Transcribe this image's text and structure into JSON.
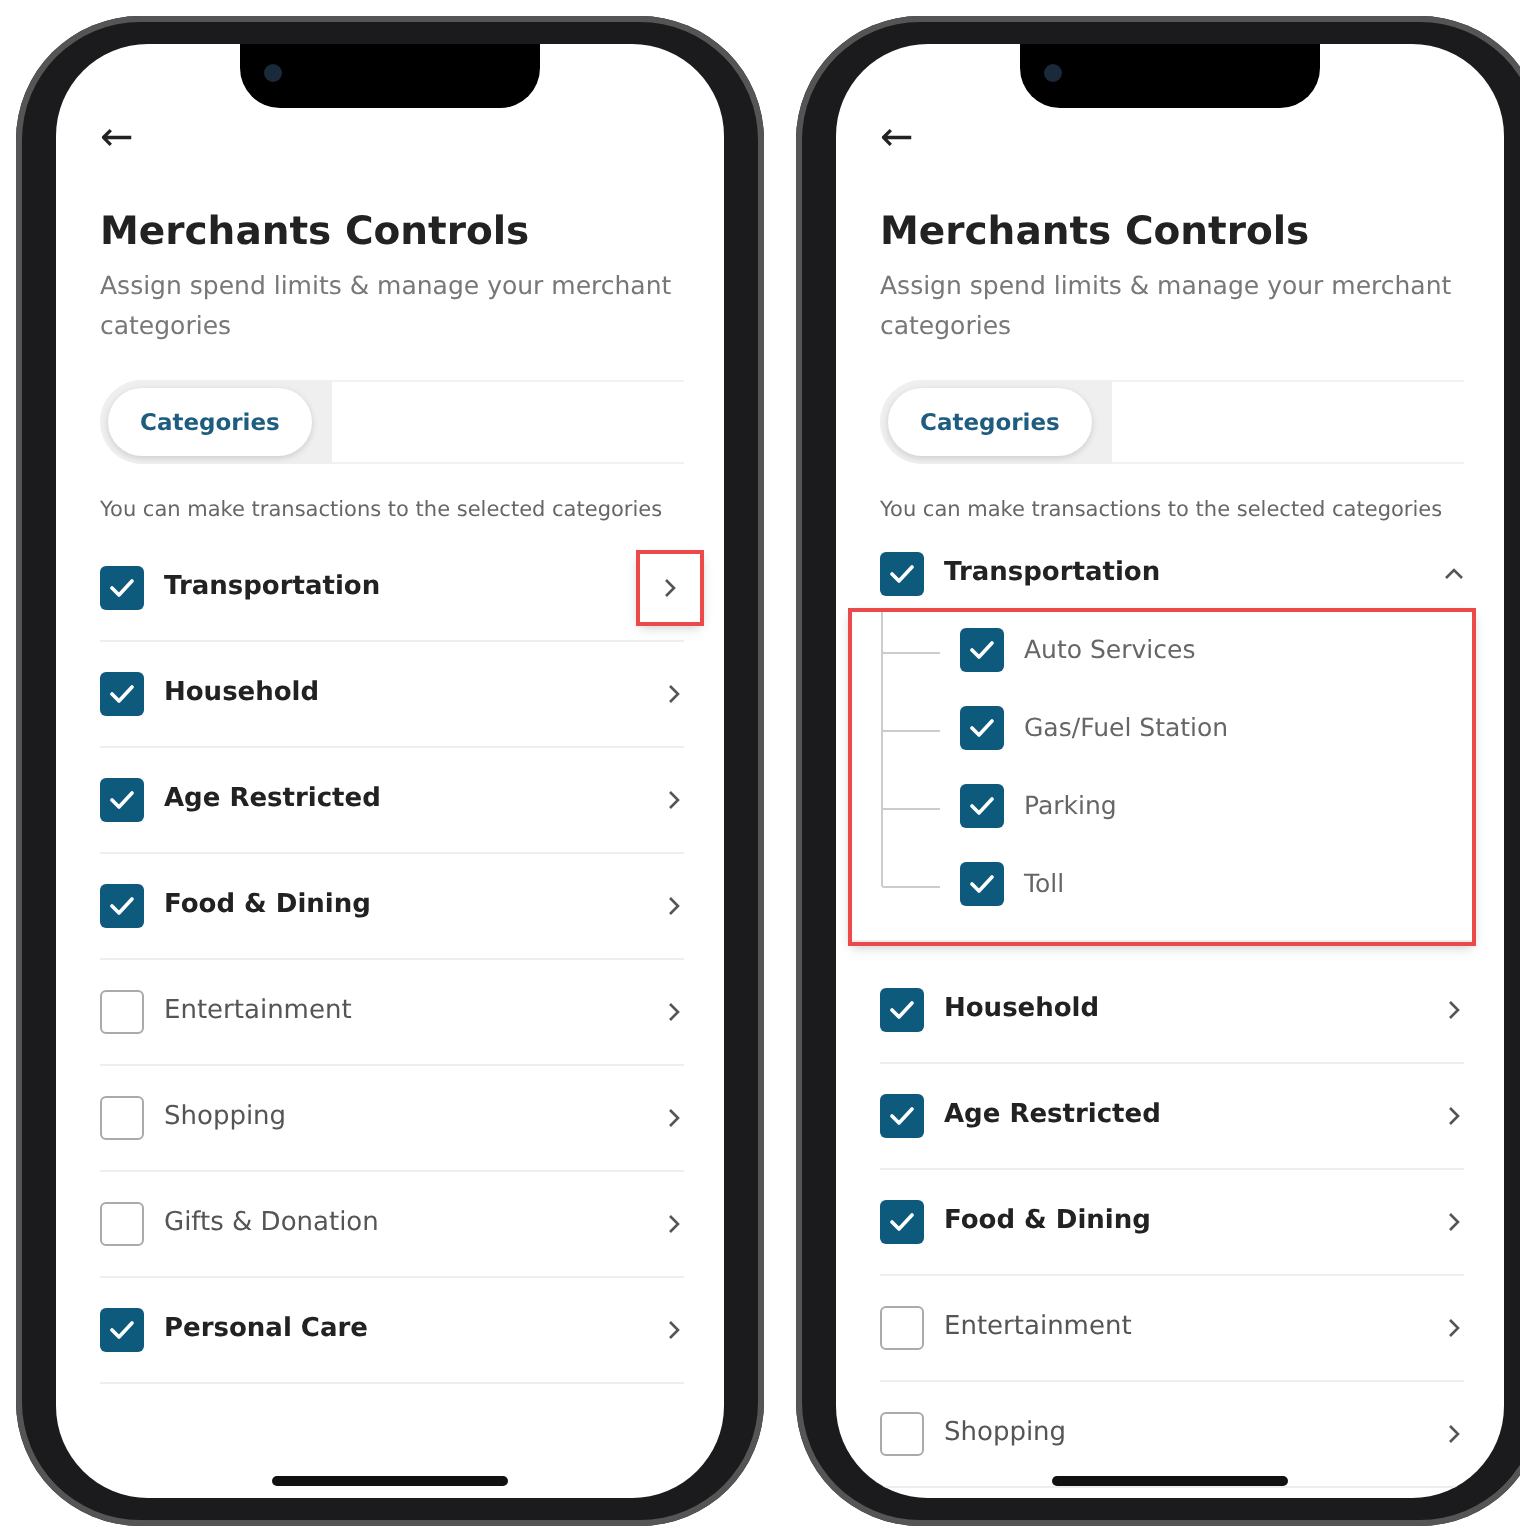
{
  "phones": [
    {
      "back": "←",
      "title": "Merchants Controls",
      "subtitle": "Assign spend limits & manage your merchant categories",
      "tabs": [
        {
          "label": "Categories",
          "selected": true
        }
      ],
      "hint": "You can make transactions to the selected categories",
      "categories": [
        {
          "label": "Transportation",
          "checked": true,
          "expanded": false,
          "chevron_highlighted": true
        },
        {
          "label": "Household",
          "checked": true,
          "expanded": false
        },
        {
          "label": "Age Restricted",
          "checked": true,
          "expanded": false
        },
        {
          "label": "Food & Dining",
          "checked": true,
          "expanded": false
        },
        {
          "label": "Entertainment",
          "checked": false,
          "expanded": false
        },
        {
          "label": "Shopping",
          "checked": false,
          "expanded": false
        },
        {
          "label": "Gifts & Donation",
          "checked": false,
          "expanded": false
        },
        {
          "label": "Personal Care",
          "checked": true,
          "expanded": false
        }
      ]
    },
    {
      "back": "←",
      "title": "Merchants Controls",
      "subtitle": "Assign spend limits & manage your merchant categories",
      "tabs": [
        {
          "label": "Categories",
          "selected": true
        }
      ],
      "hint": "You can make transactions to the selected categories",
      "categories": [
        {
          "label": "Transportation",
          "checked": true,
          "expanded": true,
          "children_highlighted": true,
          "children": [
            {
              "label": "Auto Services",
              "checked": true
            },
            {
              "label": "Gas/Fuel Station",
              "checked": true
            },
            {
              "label": "Parking",
              "checked": true
            },
            {
              "label": "Toll",
              "checked": true
            }
          ]
        },
        {
          "label": "Household",
          "checked": true,
          "expanded": false
        },
        {
          "label": "Age Restricted",
          "checked": true,
          "expanded": false
        },
        {
          "label": "Food & Dining",
          "checked": true,
          "expanded": false
        },
        {
          "label": "Entertainment",
          "checked": false,
          "expanded": false
        },
        {
          "label": "Shopping",
          "checked": false,
          "expanded": false
        }
      ]
    }
  ]
}
